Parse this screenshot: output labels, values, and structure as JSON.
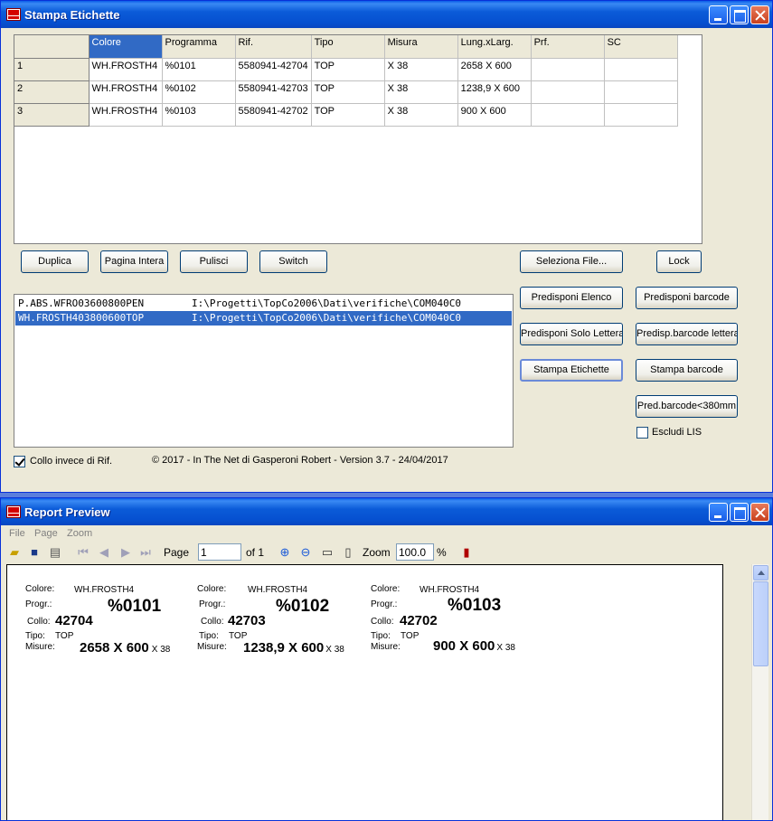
{
  "win1": {
    "title": "Stampa Etichette",
    "grid": {
      "headers": [
        "",
        "Colore",
        "Programma",
        "Rif.",
        "Tipo",
        "Misura",
        "Lung.xLarg.",
        "Prf.",
        "SC"
      ],
      "rows": [
        [
          "1",
          "WH.FROSTH4",
          "%0101",
          "5580941-42704",
          "TOP",
          "X 38",
          "2658 X 600",
          "",
          ""
        ],
        [
          "2",
          "WH.FROSTH4",
          "%0102",
          "5580941-42703",
          "TOP",
          "X 38",
          "1238,9 X 600",
          "",
          ""
        ],
        [
          "3",
          "WH.FROSTH4",
          "%0103",
          "5580941-42702",
          "TOP",
          "X 38",
          "900 X 600",
          "",
          ""
        ]
      ]
    },
    "buttons": {
      "duplica": "Duplica",
      "pagina_intera": "Pagina Intera",
      "pulisci": "Pulisci",
      "switch": "Switch",
      "seleziona_file": "Seleziona File...",
      "lock": "Lock",
      "predisponi_elenco": "Predisponi Elenco",
      "predisponi_barcode": "Predisponi barcode",
      "predisponi_solo_lettera": "Predisponi Solo Lettera",
      "predisp_barcode_lettera": "Predisp.barcode lettera",
      "stampa_etichette": "Stampa Etichette",
      "stampa_barcode": "Stampa barcode",
      "pred_barcode_380": "Pred.barcode<380mm"
    },
    "files": [
      {
        "name": "P.ABS.WFRO03600800PEN",
        "path": "I:\\Progetti\\TopCo2006\\Dati\\verifiche\\COM040C0"
      },
      {
        "name": "WH.FROSTH403800600TOP",
        "path": "I:\\Progetti\\TopCo2006\\Dati\\verifiche\\COM040C0"
      }
    ],
    "escludi_lis": "Escludi LIS",
    "collo_invece": "Collo invece di Rif.",
    "copyright": "© 2017 - In The Net di Gasperoni Robert - Version 3.7 - 24/04/2017"
  },
  "win2": {
    "title": "Report Preview",
    "menu": [
      "File",
      "Page",
      "Zoom"
    ],
    "toolbar": {
      "page_label": "Page",
      "page_value": "1",
      "of_label": "of 1",
      "zoom_label": "Zoom",
      "zoom_value": "100.0",
      "percent": "%"
    },
    "labels": [
      {
        "colore_lbl": "Colore:",
        "colore": "WH.FROSTH4",
        "progr_lbl": "Progr.:",
        "progr": "%0101",
        "collo_lbl": "Collo:",
        "collo": "42704",
        "tipo_lbl": "Tipo:",
        "tipo": "TOP",
        "misure_lbl": "Misure:",
        "misure": "2658 X 600",
        "spessore": "X 38"
      },
      {
        "colore_lbl": "Colore:",
        "colore": "WH.FROSTH4",
        "progr_lbl": "Progr.:",
        "progr": "%0102",
        "collo_lbl": "Collo:",
        "collo": "42703",
        "tipo_lbl": "Tipo:",
        "tipo": "TOP",
        "misure_lbl": "Misure:",
        "misure": "1238,9 X 600",
        "spessore": "X 38"
      },
      {
        "colore_lbl": "Colore:",
        "colore": "WH.FROSTH4",
        "progr_lbl": "Progr.:",
        "progr": "%0103",
        "collo_lbl": "Collo:",
        "collo": "42702",
        "tipo_lbl": "Tipo:",
        "tipo": "TOP",
        "misure_lbl": "Misure:",
        "misure": "900 X 600",
        "spessore": "X 38"
      }
    ]
  }
}
